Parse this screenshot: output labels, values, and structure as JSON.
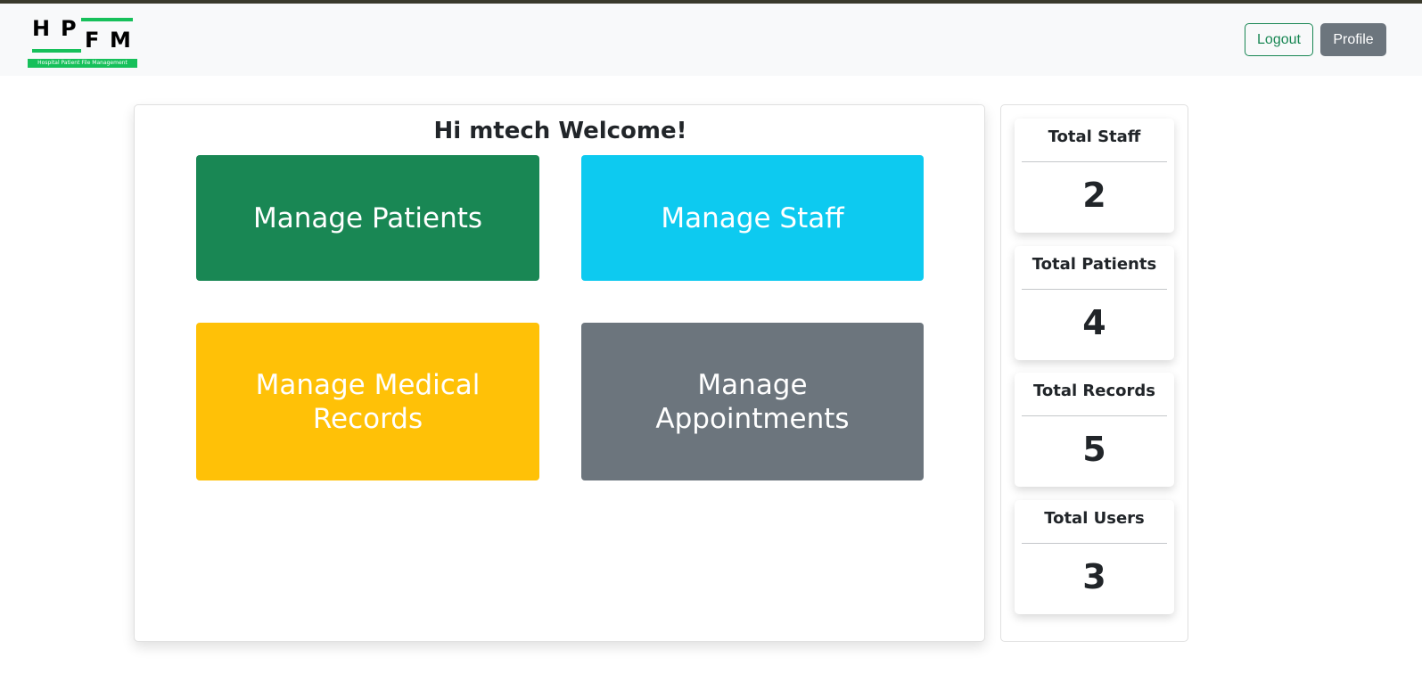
{
  "logo": {
    "letters": [
      "H",
      "P",
      "F",
      "M"
    ],
    "tagline": "Hospital Patient File Management",
    "accent_color": "#16c05a"
  },
  "navbar": {
    "logout_label": "Logout",
    "profile_label": "Profile"
  },
  "main": {
    "welcome": "Hi mtech Welcome!",
    "tiles": [
      {
        "label": "Manage Patients",
        "color": "#198754"
      },
      {
        "label": "Manage Staff",
        "color": "#0dcaf0"
      },
      {
        "label": "Manage Medical Records",
        "color": "#ffc107"
      },
      {
        "label": "Manage Appointments",
        "color": "#6c757d"
      }
    ]
  },
  "stats": [
    {
      "label": "Total Staff",
      "value": "2"
    },
    {
      "label": "Total Patients",
      "value": "4"
    },
    {
      "label": "Total Records",
      "value": "5"
    },
    {
      "label": "Total Users",
      "value": "3"
    }
  ]
}
